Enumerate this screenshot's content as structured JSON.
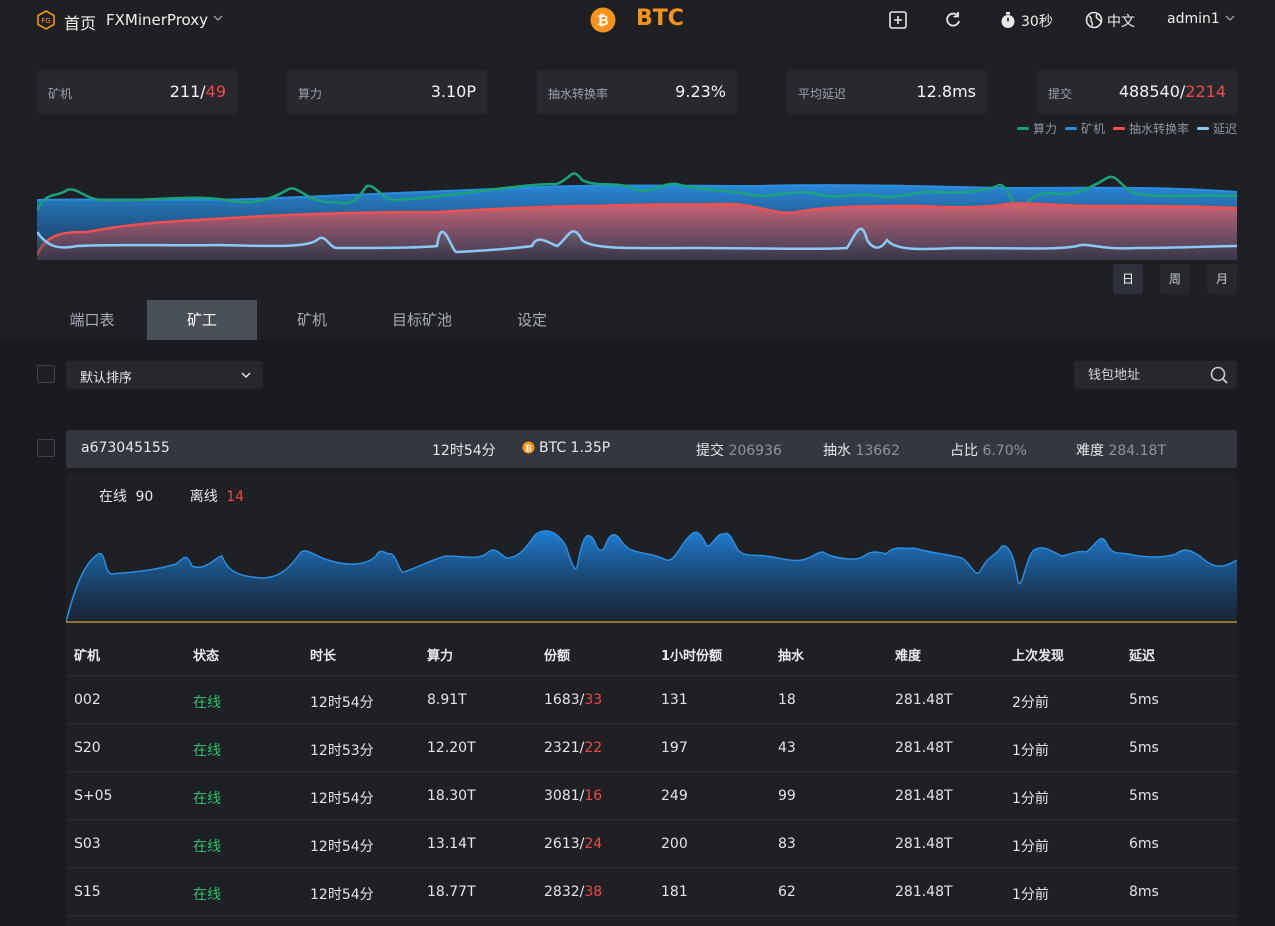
{
  "topbar": {
    "home": "首页",
    "app_name": "FXMinerProxy",
    "coin": "BTC",
    "refresh_interval": "30秒",
    "language": "中文",
    "user": "admin1"
  },
  "stats": [
    {
      "label": "矿机",
      "value": "211/",
      "value_alert": "49"
    },
    {
      "label": "算力",
      "value": "3.10P",
      "value_alert": ""
    },
    {
      "label": "抽水转换率",
      "value": "9.23%",
      "value_alert": ""
    },
    {
      "label": "平均延迟",
      "value": "12.8ms",
      "value_alert": ""
    },
    {
      "label": "提交",
      "value": "488540/",
      "value_alert": "2214"
    }
  ],
  "legend": [
    {
      "label": "算力",
      "color": "#1aa37a"
    },
    {
      "label": "矿机",
      "color": "#2a8de0"
    },
    {
      "label": "抽水转换率",
      "color": "#f05050"
    },
    {
      "label": "延迟",
      "color": "#8cc8f5"
    }
  ],
  "ranges": [
    "日",
    "周",
    "月"
  ],
  "tabs": [
    "端口表",
    "矿工",
    "矿机",
    "目标矿池",
    "设定"
  ],
  "active_tab": "矿工",
  "filters": {
    "sort_label": "默认排序",
    "search_placeholder": "钱包地址"
  },
  "worker": {
    "name": "a673045155",
    "uptime": "12时54分",
    "hashrate": "BTC 1.35P",
    "submit_label": "提交",
    "submit_value": "206936",
    "fee_label": "抽水",
    "fee_value": "13662",
    "share_label": "占比",
    "share_value": "6.70%",
    "difficulty_label": "难度",
    "difficulty_value": "284.18T",
    "online_label": "在线",
    "online_count": "90",
    "offline_label": "离线",
    "offline_count": "14"
  },
  "table": {
    "headers": [
      "矿机",
      "状态",
      "时长",
      "算力",
      "份额",
      "1小时份额",
      "抽水",
      "难度",
      "上次发现",
      "延迟"
    ],
    "rows": [
      {
        "name": "002",
        "status": "在线",
        "uptime": "12时54分",
        "hashrate": "8.91T",
        "shares": "1683/",
        "shares_bad": "33",
        "hour_shares": "131",
        "fee": "18",
        "difficulty": "281.48T",
        "last_found": "2分前",
        "latency": "5ms"
      },
      {
        "name": "S20",
        "status": "在线",
        "uptime": "12时53分",
        "hashrate": "12.20T",
        "shares": "2321/",
        "shares_bad": "22",
        "hour_shares": "197",
        "fee": "43",
        "difficulty": "281.48T",
        "last_found": "1分前",
        "latency": "5ms"
      },
      {
        "name": "S+05",
        "status": "在线",
        "uptime": "12时54分",
        "hashrate": "18.30T",
        "shares": "3081/",
        "shares_bad": "16",
        "hour_shares": "249",
        "fee": "99",
        "difficulty": "281.48T",
        "last_found": "1分前",
        "latency": "5ms"
      },
      {
        "name": "S03",
        "status": "在线",
        "uptime": "12时54分",
        "hashrate": "13.14T",
        "shares": "2613/",
        "shares_bad": "24",
        "hour_shares": "200",
        "fee": "83",
        "difficulty": "281.48T",
        "last_found": "1分前",
        "latency": "6ms"
      },
      {
        "name": "S15",
        "status": "在线",
        "uptime": "12时54分",
        "hashrate": "18.77T",
        "shares": "2832/",
        "shares_bad": "38",
        "hour_shares": "181",
        "fee": "62",
        "difficulty": "281.48T",
        "last_found": "1分前",
        "latency": "8ms"
      }
    ]
  }
}
